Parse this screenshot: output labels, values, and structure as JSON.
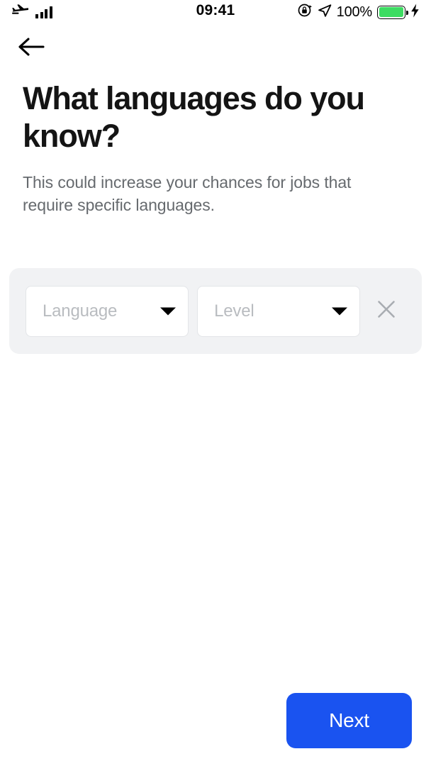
{
  "status_bar": {
    "airplane_icon": "airplane-icon",
    "signal_icon": "signal-bars-icon",
    "time": "09:41",
    "rotation_lock_icon": "rotation-lock-icon",
    "location_icon": "location-arrow-icon",
    "battery_percent": "100%",
    "battery_icon": "battery-full-icon",
    "charging_icon": "lightning-bolt-icon",
    "battery_color": "#3ddc62"
  },
  "nav": {
    "back_icon": "arrow-left-icon"
  },
  "page": {
    "title": "What languages do you know?",
    "subtitle": "This could increase your chances for jobs that require specific languages."
  },
  "language_row": {
    "language_select": {
      "placeholder": "Language",
      "value": "",
      "caret_icon": "chevron-down-icon"
    },
    "level_select": {
      "placeholder": "Level",
      "value": "",
      "caret_icon": "chevron-down-icon"
    },
    "remove_icon": "close-x-icon"
  },
  "footer": {
    "next_label": "Next",
    "accent_color": "#1a53f0"
  }
}
